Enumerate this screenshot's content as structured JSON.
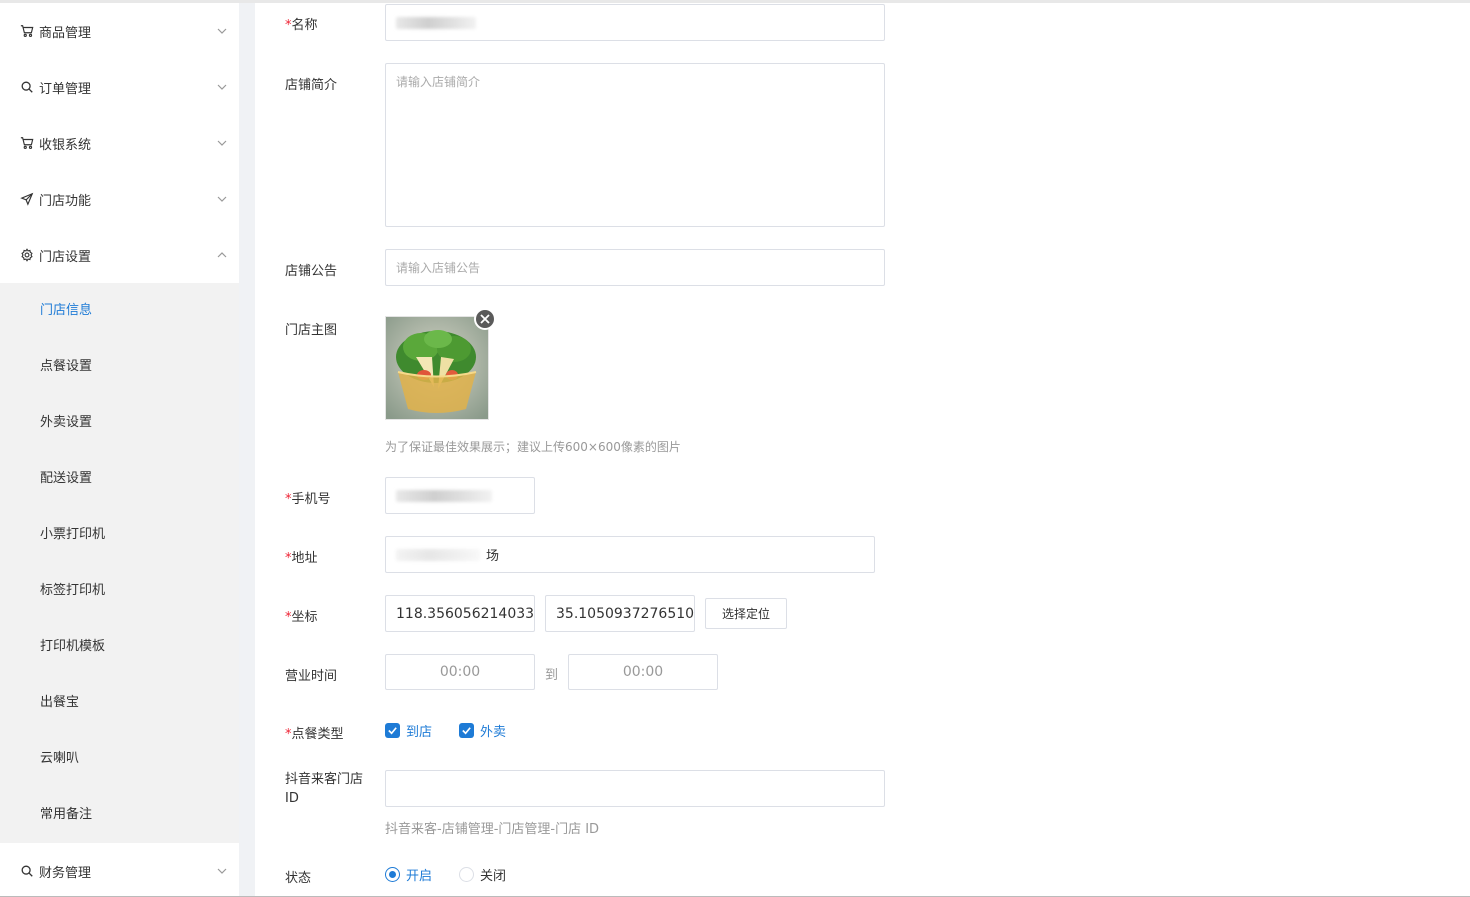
{
  "sidebar": {
    "groups": [
      {
        "label": "商品管理",
        "icon": "cart-icon"
      },
      {
        "label": "订单管理",
        "icon": "search-icon"
      },
      {
        "label": "收银系统",
        "icon": "cart-icon"
      },
      {
        "label": "门店功能",
        "icon": "send-icon"
      },
      {
        "label": "门店设置",
        "icon": "gear-icon",
        "expanded": true
      }
    ],
    "submenu": [
      {
        "label": "门店信息",
        "active": true
      },
      {
        "label": "点餐设置"
      },
      {
        "label": "外卖设置"
      },
      {
        "label": "配送设置"
      },
      {
        "label": "小票打印机"
      },
      {
        "label": "标签打印机"
      },
      {
        "label": "打印机模板"
      },
      {
        "label": "出餐宝"
      },
      {
        "label": "云喇叭"
      },
      {
        "label": "常用备注"
      }
    ],
    "after": [
      {
        "label": "财务管理",
        "icon": "search-icon"
      }
    ]
  },
  "form": {
    "required_mark": "*",
    "name": {
      "label": "名称",
      "value": ""
    },
    "intro": {
      "label": "店铺简介",
      "placeholder": "请输入店铺简介"
    },
    "notice": {
      "label": "店铺公告",
      "placeholder": "请输入店铺公告"
    },
    "main_image": {
      "label": "门店主图",
      "hint": "为了保证最佳效果展示；建议上传600×600像素的图片"
    },
    "phone": {
      "label": "手机号",
      "value": ""
    },
    "address": {
      "label": "地址",
      "value_tail": "场"
    },
    "coords": {
      "label": "坐标",
      "lng": "118.356056214033",
      "lat": "35.1050937276510",
      "locate_button": "选择定位"
    },
    "hours": {
      "label": "营业时间",
      "start": "00:00",
      "end": "00:00",
      "sep": "到"
    },
    "order_type": {
      "label": "点餐类型",
      "options": [
        "到店",
        "外卖"
      ]
    },
    "douyin": {
      "label": "抖音来客门店ID",
      "value": "",
      "hint": "抖音来客-店铺管理-门店管理-门店 ID"
    },
    "status": {
      "label": "状态",
      "on": "开启",
      "off": "关闭"
    }
  },
  "colors": {
    "accent": "#1e7bd6",
    "required": "#ee2233"
  }
}
